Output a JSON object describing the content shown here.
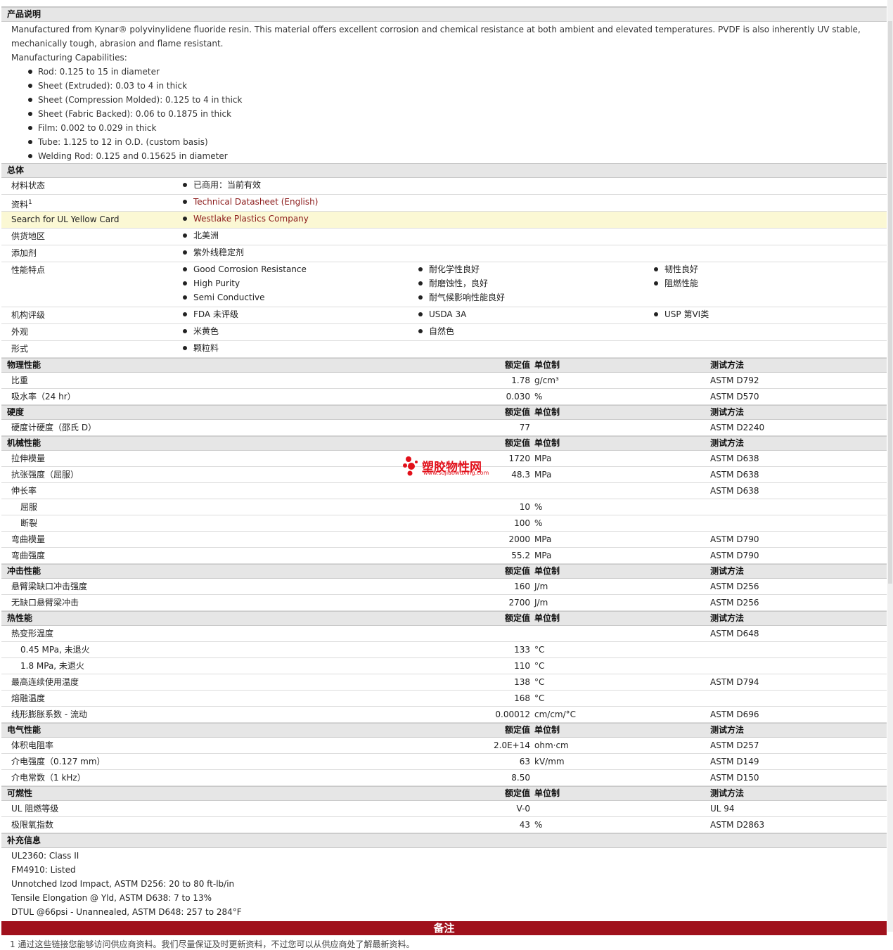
{
  "intro": {
    "section_title": "产品说明",
    "description": "Manufactured from Kynar® polyvinylidene fluoride resin. This material offers excellent corrosion and chemical resistance at both ambient and elevated temperatures. PVDF is also inherently UV stable, mechanically tough, abrasion and flame resistant.",
    "cap_title": "Manufacturing Capabilities:",
    "capabilities": [
      "Rod: 0.125 to 15 in diameter",
      "Sheet (Extruded): 0.03 to 4 in thick",
      "Sheet (Compression Molded): 0.125 to 4 in thick",
      "Sheet (Fabric Backed): 0.06 to 0.1875 in thick",
      "Film: 0.002 to 0.029 in thick",
      "Tube: 1.125 to 12 in O.D. (custom basis)",
      "Welding Rod: 0.125 and 0.15625 in diameter"
    ]
  },
  "general": {
    "section_title": "总体",
    "rows": [
      {
        "label": "材料状态",
        "cols": [
          [
            "已商用：当前有效"
          ]
        ]
      },
      {
        "label": "资料",
        "sup": "1",
        "link": true,
        "cols": [
          [
            "Technical Datasheet (English)"
          ]
        ]
      },
      {
        "label": "Search for UL Yellow Card",
        "link": true,
        "highlight": true,
        "cols": [
          [
            "Westlake Plastics Company"
          ]
        ]
      },
      {
        "label": "供货地区",
        "cols": [
          [
            "北美洲"
          ]
        ]
      },
      {
        "label": "添加剂",
        "cols": [
          [
            "紫外线稳定剂"
          ]
        ]
      },
      {
        "label": "性能特点",
        "cols": [
          [
            "Good Corrosion Resistance",
            "High Purity",
            "Semi Conductive"
          ],
          [
            "耐化学性良好",
            "耐磨蚀性，良好",
            "耐气候影响性能良好"
          ],
          [
            "韧性良好",
            "阻燃性能"
          ]
        ]
      },
      {
        "label": "机构评级",
        "cols": [
          [
            "FDA 未评级"
          ],
          [
            "USDA 3A"
          ],
          [
            "USP 第VI类"
          ]
        ]
      },
      {
        "label": "外观",
        "cols": [
          [
            "米黄色"
          ],
          [
            "自然色"
          ]
        ]
      },
      {
        "label": "形式",
        "cols": [
          [
            "颗粒料"
          ]
        ]
      }
    ]
  },
  "col_headers": {
    "value": "额定值",
    "unit": "单位制",
    "method": "测试方法"
  },
  "prop_sections": [
    {
      "title": "物理性能",
      "rows": [
        {
          "label": "比重",
          "value": "1.78",
          "unit": "g/cm³",
          "method": "ASTM D792"
        },
        {
          "label": "吸水率（24 hr）",
          "value": "0.030",
          "unit": "%",
          "method": "ASTM D570"
        }
      ]
    },
    {
      "title": "硬度",
      "rows": [
        {
          "label": "硬度计硬度（邵氏 D）",
          "value": "77",
          "unit": "",
          "method": "ASTM D2240"
        }
      ]
    },
    {
      "title": "机械性能",
      "rows": [
        {
          "label": "拉伸模量",
          "value": "1720",
          "unit": "MPa",
          "method": "ASTM D638"
        },
        {
          "label": "抗张强度（屈服）",
          "value": "48.3",
          "unit": "MPa",
          "method": "ASTM D638"
        },
        {
          "label": "伸长率",
          "value": "",
          "unit": "",
          "method": "ASTM D638"
        },
        {
          "label": "屈服",
          "indent": true,
          "value": "10",
          "unit": "%",
          "method": ""
        },
        {
          "label": "断裂",
          "indent": true,
          "value": "100",
          "unit": "%",
          "method": ""
        },
        {
          "label": "弯曲模量",
          "value": "2000",
          "unit": "MPa",
          "method": "ASTM D790"
        },
        {
          "label": "弯曲强度",
          "value": "55.2",
          "unit": "MPa",
          "method": "ASTM D790"
        }
      ]
    },
    {
      "title": "冲击性能",
      "rows": [
        {
          "label": "悬臂梁缺口冲击强度",
          "value": "160",
          "unit": "J/m",
          "method": "ASTM D256"
        },
        {
          "label": "无缺口悬臂梁冲击",
          "value": "2700",
          "unit": "J/m",
          "method": "ASTM D256"
        }
      ]
    },
    {
      "title": "热性能",
      "rows": [
        {
          "label": "热变形温度",
          "value": "",
          "unit": "",
          "method": "ASTM D648"
        },
        {
          "label": "0.45 MPa, 未退火",
          "indent": true,
          "value": "133",
          "unit": "°C",
          "method": ""
        },
        {
          "label": "1.8 MPa, 未退火",
          "indent": true,
          "value": "110",
          "unit": "°C",
          "method": ""
        },
        {
          "label": "最高连续使用温度",
          "value": "138",
          "unit": "°C",
          "method": "ASTM D794"
        },
        {
          "label": "熔融温度",
          "value": "168",
          "unit": "°C",
          "method": ""
        },
        {
          "label": "线形膨胀系数 - 流动",
          "value": "0.00012",
          "unit": "cm/cm/°C",
          "method": "ASTM D696"
        }
      ]
    },
    {
      "title": "电气性能",
      "rows": [
        {
          "label": "体积电阻率",
          "value": "2.0E+14",
          "unit": "ohm·cm",
          "method": "ASTM D257"
        },
        {
          "label": "介电强度（0.127 mm）",
          "value": "63",
          "unit": "kV/mm",
          "method": "ASTM D149"
        },
        {
          "label": "介电常数（1 kHz）",
          "value": "8.50",
          "unit": "",
          "method": "ASTM D150"
        }
      ]
    },
    {
      "title": "可燃性",
      "rows": [
        {
          "label": "UL 阻燃等级",
          "value": "V-0",
          "unit": "",
          "method": "UL 94"
        },
        {
          "label": "极限氧指数",
          "value": "43",
          "unit": "%",
          "method": "ASTM D2863"
        }
      ]
    }
  ],
  "supplement": {
    "title": "补充信息",
    "lines": [
      "UL2360: Class II",
      "FM4910: Listed",
      "Unnotched Izod Impact, ASTM D256: 20 to 80 ft-lb/in",
      "Tensile Elongation @ Yld, ASTM D638: 7 to 13%",
      "DTUL @66psi - Unannealed, ASTM D648: 257 to 284°F"
    ]
  },
  "footer": {
    "title": "备注",
    "note": "1 通过这些链接您能够访问供应商资料。我们尽量保证及时更新资料，不过您可以从供应商处了解最新资料。"
  },
  "watermark": {
    "name": "塑胶物性网",
    "url": "www.sujiaowuxing.com"
  }
}
